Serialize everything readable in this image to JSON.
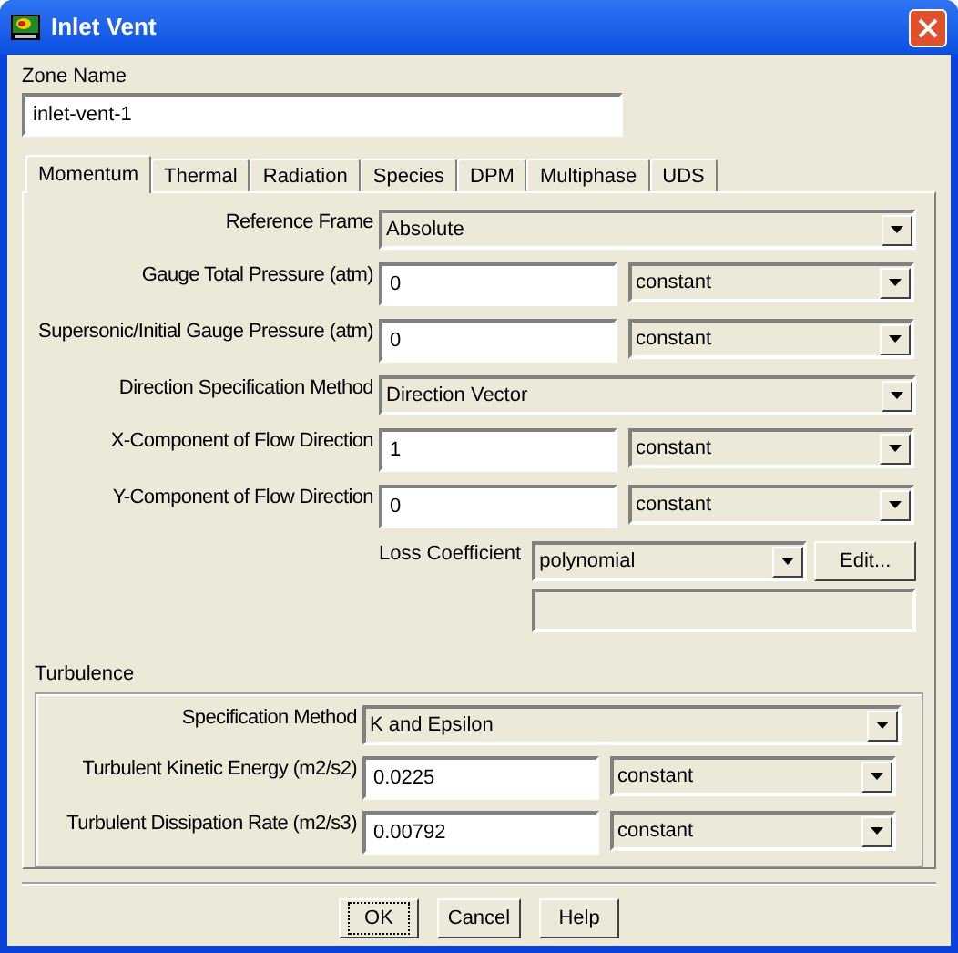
{
  "window": {
    "title": "Inlet Vent"
  },
  "zone_name": {
    "label": "Zone Name",
    "value": "inlet-vent-1"
  },
  "tabs": [
    {
      "label": "Momentum",
      "selected": true
    },
    {
      "label": "Thermal",
      "selected": false
    },
    {
      "label": "Radiation",
      "selected": false
    },
    {
      "label": "Species",
      "selected": false
    },
    {
      "label": "DPM",
      "selected": false
    },
    {
      "label": "Multiphase",
      "selected": false
    },
    {
      "label": "UDS",
      "selected": false
    }
  ],
  "momentum": {
    "rows": [
      {
        "kind": "select",
        "label": "Reference Frame",
        "value": "Absolute"
      },
      {
        "kind": "value",
        "label": "Gauge Total Pressure (atm)",
        "value": "0",
        "method": "constant"
      },
      {
        "kind": "value",
        "label": "Supersonic/Initial Gauge Pressure (atm)",
        "value": "0",
        "method": "constant"
      },
      {
        "kind": "select",
        "label": "Direction Specification Method",
        "value": "Direction Vector"
      },
      {
        "kind": "value",
        "label": "X-Component of Flow Direction",
        "value": "1",
        "method": "constant"
      },
      {
        "kind": "value",
        "label": "Y-Component of Flow Direction",
        "value": "0",
        "method": "constant"
      },
      {
        "kind": "loss",
        "label": "Loss Coefficient",
        "value": "polynomial",
        "button": "Edit..."
      }
    ]
  },
  "turbulence": {
    "title": "Turbulence",
    "rows": [
      {
        "kind": "select",
        "label": "Specification Method",
        "value": "K and Epsilon"
      },
      {
        "kind": "value",
        "label": "Turbulent Kinetic Energy (m2/s2)",
        "value": "0.0225",
        "method": "constant"
      },
      {
        "kind": "value",
        "label": "Turbulent Dissipation Rate (m2/s3)",
        "value": "0.00792",
        "method": "constant"
      }
    ]
  },
  "buttons": [
    {
      "label": "OK",
      "focused": true
    },
    {
      "label": "Cancel",
      "focused": false
    },
    {
      "label": "Help",
      "focused": false
    }
  ]
}
